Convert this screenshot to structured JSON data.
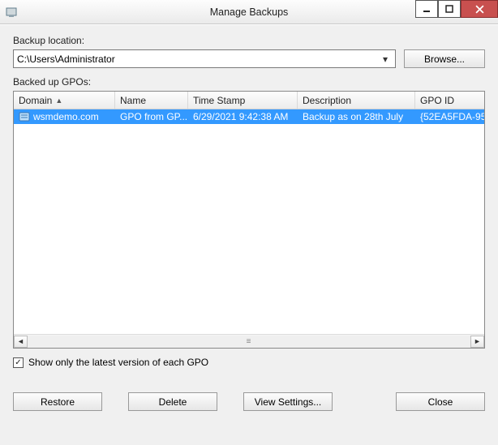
{
  "window": {
    "title": "Manage Backups"
  },
  "location": {
    "label": "Backup location:",
    "value": "C:\\Users\\Administrator",
    "browse_label": "Browse..."
  },
  "list": {
    "label": "Backed up GPOs:",
    "columns": {
      "domain": "Domain",
      "name": "Name",
      "time": "Time Stamp",
      "desc": "Description",
      "gpoid": "GPO ID"
    },
    "rows": [
      {
        "domain": "wsmdemo.com",
        "name": "GPO from GP...",
        "time": "6/29/2021 9:42:38 AM",
        "desc": "Backup as on 28th July",
        "gpoid": "{52EA5FDA-95..."
      }
    ]
  },
  "options": {
    "show_latest_label": "Show only the latest version of each GPO",
    "show_latest_checked": true
  },
  "actions": {
    "restore": "Restore",
    "delete": "Delete",
    "view": "View Settings...",
    "close": "Close"
  }
}
